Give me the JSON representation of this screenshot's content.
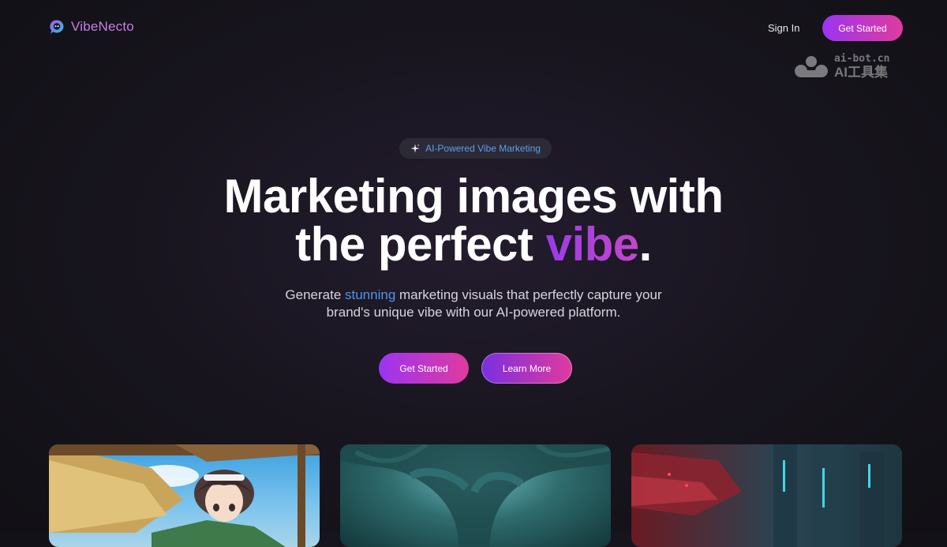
{
  "nav": {
    "brand": "VibeNecto",
    "sign_in": "Sign In",
    "cta": "Get Started"
  },
  "watermark": {
    "line1": "ai-bot.cn",
    "line2": "AI工具集"
  },
  "hero": {
    "badge": "AI-Powered Vibe Marketing",
    "title_line1": "Marketing images with",
    "title_line2_pre": "the perfect ",
    "title_line2_highlight": "vibe",
    "title_line2_post": ".",
    "subtitle_pre": "Generate ",
    "subtitle_highlight": "stunning",
    "subtitle_mid": " marketing visuals that perfectly capture your",
    "subtitle_line2": "brand's unique vibe with our AI-powered platform.",
    "primary_cta": "Get Started",
    "secondary_cta": "Learn More"
  },
  "colors": {
    "accent_purple": "#9b35f0",
    "accent_pink": "#e03a9e",
    "accent_blue": "#4e94ec",
    "background": "#17141d"
  },
  "icons": {
    "brand": "chat-bubble-logo-icon",
    "badge": "sparkle-icon"
  }
}
